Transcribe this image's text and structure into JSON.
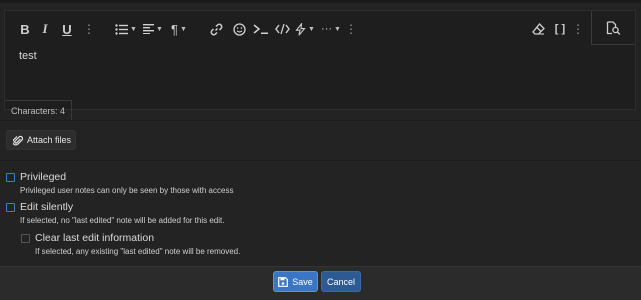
{
  "editor": {
    "toolbar": {
      "bold": "B",
      "italic": "I",
      "underline": "U",
      "more": "⋮",
      "list": "☰",
      "align": "☰",
      "paragraph": "¶",
      "link": "🔗",
      "emoji": "☺",
      "code_inline": "≻_",
      "code_block": "</>",
      "insert": "⚡",
      "more_options": "···",
      "clear_format": "⌫",
      "brackets": "[ ]"
    },
    "content": "test",
    "char_count": "Characters: 4"
  },
  "attach": {
    "label": "Attach files"
  },
  "options": [
    {
      "label": "Privileged",
      "hint": "Privileged user notes can only be seen by those with access"
    },
    {
      "label": "Edit silently",
      "hint": "If selected, no \"last edited\" note will be added for this edit."
    },
    {
      "label": "Clear last edit information",
      "hint": "If selected, any existing \"last edited\" note will be removed."
    }
  ],
  "footer": {
    "save_label": "Save",
    "cancel_label": "Cancel"
  },
  "colors": {
    "accent": "#3a76c4",
    "accent_dark": "#2d5a92",
    "checkbox_border": "#3d7bd1",
    "background": "#232323"
  }
}
